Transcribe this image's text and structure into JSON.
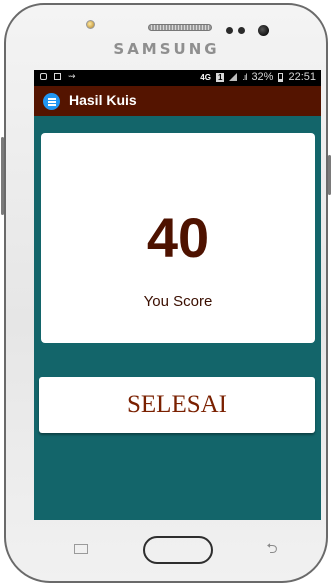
{
  "device": {
    "brand": "SAMSUNG"
  },
  "status_bar": {
    "network": "4G",
    "sim": "1",
    "battery": "32%",
    "time": "22:51"
  },
  "app_bar": {
    "title": "Hasil Kuis",
    "icon": "list-icon"
  },
  "result": {
    "score": "40",
    "label": "You Score"
  },
  "actions": {
    "finish_label": "SELESAI"
  },
  "nav": {
    "recent_icon": "recent-apps-icon",
    "home_icon": "home-icon",
    "back_icon": "back-icon"
  },
  "colors": {
    "background": "#13656a",
    "app_bar": "#541400",
    "score_text": "#4e1200",
    "button_text": "#7a2000"
  }
}
